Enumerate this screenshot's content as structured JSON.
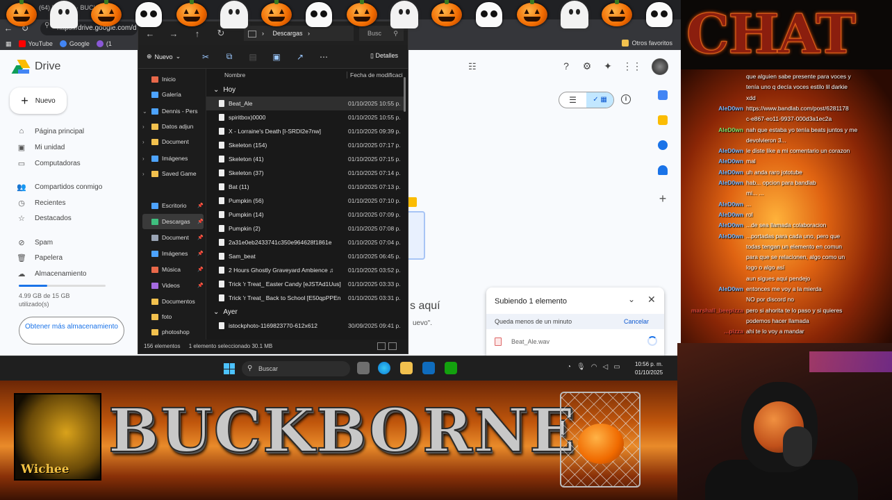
{
  "chrome": {
    "tab_title": "(64) BUT... V · BUCK",
    "url": "https://drive.google.com/d",
    "bookmarks": [
      {
        "label": "YouTube",
        "color": "#ff0000"
      },
      {
        "label": "Google",
        "color": "#4285f4"
      },
      {
        "label": "(1",
        "color": "#8a58d6"
      }
    ],
    "other_bookmarks": "Otros favoritos"
  },
  "drive": {
    "title": "Drive",
    "new_label": "Nuevo",
    "sidebar": [
      {
        "label": "Página principal",
        "icon": "home-icon"
      },
      {
        "label": "Mi unidad",
        "icon": "my-drive-icon"
      },
      {
        "label": "Computadoras",
        "icon": "computer-icon"
      },
      {
        "label": "Compartidos conmigo",
        "icon": "shared-icon"
      },
      {
        "label": "Recientes",
        "icon": "clock-icon"
      },
      {
        "label": "Destacados",
        "icon": "star-icon"
      },
      {
        "label": "Spam",
        "icon": "spam-icon"
      },
      {
        "label": "Papelera",
        "icon": "trash-icon"
      },
      {
        "label": "Almacenamiento",
        "icon": "cloud-icon"
      }
    ],
    "storage_used_fraction": 0.33,
    "storage_text": "4.99 GB de 15 GB utilizado(s)",
    "get_more": "Obtener más almacenamiento",
    "drop_text": "s aquí",
    "drop_sub": "uevo\"."
  },
  "upload": {
    "title": "Subiendo 1 elemento",
    "status": "Queda menos de un minuto",
    "cancel": "Cancelar",
    "file": "Beat_Ale.wav"
  },
  "explorer": {
    "path": "Descargas",
    "search": "Busc",
    "new_label": "Nuevo",
    "details": "Detalles",
    "nav": [
      {
        "label": "Inicio",
        "color": "#e8684a",
        "indent": 1
      },
      {
        "label": "Galería",
        "color": "#4da3ff",
        "indent": 1
      },
      {
        "label": "Dennis - Pers",
        "color": "#4da3ff",
        "indent": 0
      },
      {
        "label": "Datos adjun",
        "color": "#f2c14e",
        "indent": 1
      },
      {
        "label": "Document",
        "color": "#f2c14e",
        "indent": 1
      },
      {
        "label": "Imágenes",
        "color": "#4da3ff",
        "indent": 1
      },
      {
        "label": "Saved Game",
        "color": "#f2c14e",
        "indent": 1
      },
      {
        "label": "Escritorio",
        "color": "#4da3ff",
        "indent": 1
      },
      {
        "label": "Descargas",
        "color": "#3fbf7f",
        "indent": 1
      },
      {
        "label": "Document",
        "color": "#9aa4b4",
        "indent": 1
      },
      {
        "label": "Imágenes",
        "color": "#4da3ff",
        "indent": 1
      },
      {
        "label": "Música",
        "color": "#e8684a",
        "indent": 1
      },
      {
        "label": "Videos",
        "color": "#a46ae0",
        "indent": 1
      },
      {
        "label": "Documentos",
        "color": "#f2c14e",
        "indent": 1
      },
      {
        "label": "foto",
        "color": "#f2c14e",
        "indent": 1
      },
      {
        "label": "photoshop",
        "color": "#f2c14e",
        "indent": 1
      }
    ],
    "col_name": "Nombre",
    "col_date": "Fecha de modificaci",
    "group_today": "Hoy",
    "group_yesterday": "Ayer",
    "files_today": [
      {
        "name": "Beat_Ale",
        "date": "01/10/2025 10:55 p."
      },
      {
        "name": "spiritbox)0000",
        "date": "01/10/2025 10:55 p."
      },
      {
        "name": "X - Lorraine's Death [I-SRDI2e7nw]",
        "date": "01/10/2025 09:39 p."
      },
      {
        "name": "Skeleton (154)",
        "date": "01/10/2025 07:17 p."
      },
      {
        "name": "Skeleton (41)",
        "date": "01/10/2025 07:15 p."
      },
      {
        "name": "Skeleton (37)",
        "date": "01/10/2025 07:14 p."
      },
      {
        "name": "Bat (11)",
        "date": "01/10/2025 07:13 p."
      },
      {
        "name": "Pumpkin (56)",
        "date": "01/10/2025 07:10 p."
      },
      {
        "name": "Pumpkin (14)",
        "date": "01/10/2025 07:09 p."
      },
      {
        "name": "Pumpkin (2)",
        "date": "01/10/2025 07:08 p."
      },
      {
        "name": "2a31e0eb2433741c350e964628f1861e",
        "date": "01/10/2025 07:04 p."
      },
      {
        "name": "Sam_beat",
        "date": "01/10/2025 06:45 p."
      },
      {
        "name": "2 Hours Ghostly Graveyard Ambience ♫",
        "date": "01/10/2025 03:52 p."
      },
      {
        "name": "Trick 'r Treat_ Easter Candy [eJSTAd1Uus]",
        "date": "01/10/2025 03:33 p."
      },
      {
        "name": "Trick 'r Treat_ Back to School [E50qpPPEn",
        "date": "01/10/2025 03:31 p."
      }
    ],
    "files_yesterday": [
      {
        "name": "istockphoto-1169823770-612x612",
        "date": "30/09/2025 09:41 p."
      }
    ],
    "status_count": "156 elementos",
    "status_selected": "1 elemento seleccionado  30.1 MB"
  },
  "taskbar": {
    "search": "Buscar",
    "time": "10:56 p. m.",
    "date": "01/10/2025"
  },
  "overlay": {
    "brand": "BUCKBORNE",
    "portrait_label": "Wichee",
    "chat_title": "CHAT"
  },
  "chat": [
    {
      "user": "",
      "text": "que alguien sabe presente para voces y",
      "color": "#ffffff"
    },
    {
      "user": "",
      "text": "tenía uno q decía voces estilo lil darkie",
      "color": "#ffffff"
    },
    {
      "user": "",
      "text": "xdd",
      "color": "#ffffff"
    },
    {
      "user": "AleD0wn",
      "text": "https://www.bandlab.com/post/6281178",
      "color": "#7ab8ff"
    },
    {
      "user": "",
      "text": "c-e867-eo11-9937-000d3a1ec2a",
      "color": "#ffffff"
    },
    {
      "user": "AleD0wn",
      "text": "nah que estaba yo tenía beats juntos y me",
      "color": "#7fe36b"
    },
    {
      "user": "",
      "text": "devolvieron 3...",
      "color": "#ffffff"
    },
    {
      "user": "AleD0wn",
      "text": "le diste like a mi comentario un corazon",
      "color": "#7ab8ff"
    },
    {
      "user": "AleD0wn",
      "text": "mal",
      "color": "#7ab8ff"
    },
    {
      "user": "AleD0wn",
      "text": "uh anda raro jototube",
      "color": "#7ab8ff"
    },
    {
      "user": "AleD0wn",
      "text": "hab... opcion para bandlab",
      "color": "#7ab8ff"
    },
    {
      "user": "",
      "text": "mi... ...",
      "color": "#ffffff"
    },
    {
      "user": "AleD0wn",
      "text": "...",
      "color": "#7ab8ff"
    },
    {
      "user": "AleD0wn",
      "text": "rol",
      "color": "#7ab8ff"
    },
    {
      "user": "AleD0wn",
      "text": "...de sea llamada colaboracion",
      "color": "#7ab8ff"
    },
    {
      "user": "AleD0wn",
      "text": "...portadas para cada uno, pero que",
      "color": "#7ab8ff"
    },
    {
      "user": "",
      "text": "todas tengan un elemento en comun",
      "color": "#ffffff"
    },
    {
      "user": "",
      "text": "para que se relacionen, algo como un",
      "color": "#ffffff"
    },
    {
      "user": "",
      "text": "logo o algo así",
      "color": "#ffffff"
    },
    {
      "user": "",
      "text": "aun sigues aqui pendejo",
      "color": "#ffffff"
    },
    {
      "user": "AleD0wn",
      "text": "entonces me voy a la mierda",
      "color": "#7ab8ff"
    },
    {
      "user": "",
      "text": "NO por discord no",
      "color": "#ffffff"
    },
    {
      "user": "marshall_beepizza",
      "text": "pero si ahorita te lo paso y si quieres",
      "color": "#d8463c"
    },
    {
      "user": "",
      "text": "podemos hacer llamada",
      "color": "#ffffff"
    },
    {
      "user": "...pizza",
      "text": "ahi te lo voy a mandar",
      "color": "#d8463c"
    }
  ]
}
